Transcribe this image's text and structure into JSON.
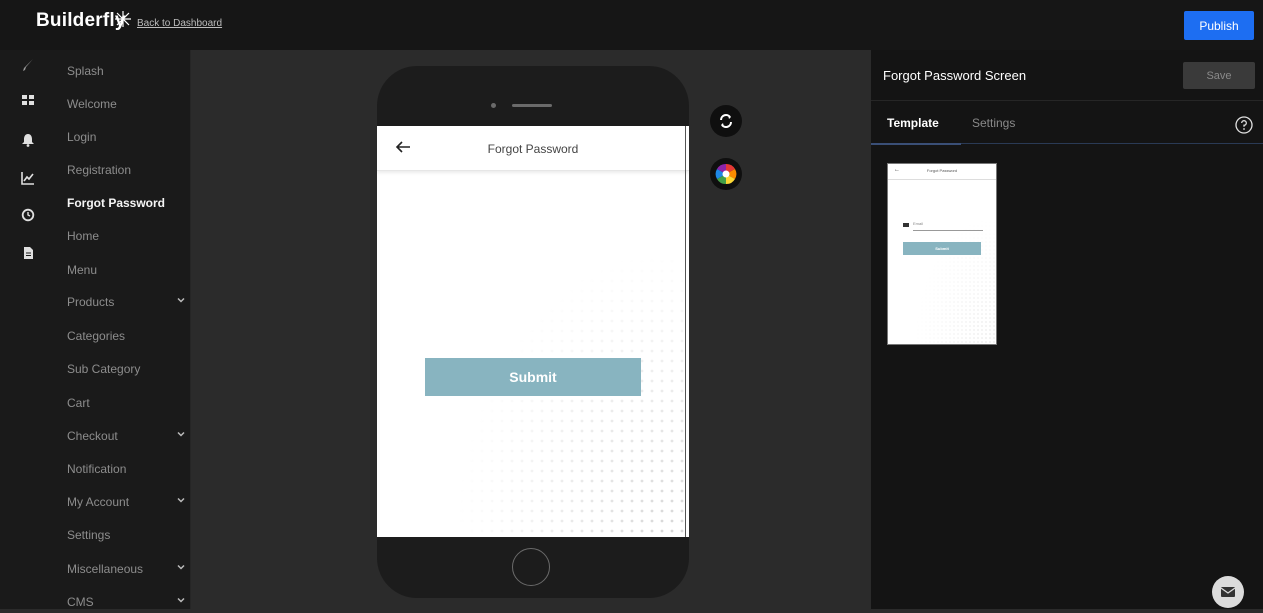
{
  "topbar": {
    "brand": "Builderfly",
    "back_link": "Back to Dashboard",
    "publish_label": "Publish"
  },
  "icon_rail": [
    "brush-icon",
    "grid-icon",
    "bell-icon",
    "chart-icon",
    "clock-icon",
    "document-icon"
  ],
  "screens": {
    "items": [
      {
        "label": "Splash"
      },
      {
        "label": "Welcome"
      },
      {
        "label": "Login"
      },
      {
        "label": "Registration"
      },
      {
        "label": "Forgot Password",
        "active": true
      },
      {
        "label": "Home"
      },
      {
        "label": "Menu"
      },
      {
        "label": "Products",
        "expandable": true
      },
      {
        "label": "Categories"
      },
      {
        "label": "Sub Category"
      },
      {
        "label": "Cart"
      },
      {
        "label": "Checkout",
        "expandable": true
      },
      {
        "label": "Notification"
      },
      {
        "label": "My Account",
        "expandable": true
      },
      {
        "label": "Settings"
      },
      {
        "label": "Miscellaneous",
        "expandable": true
      },
      {
        "label": "CMS",
        "expandable": true
      }
    ]
  },
  "preview": {
    "screen_title": "Forgot Password",
    "email_placeholder": "Email",
    "submit_label": "Submit",
    "accent_color": "#88b4c0"
  },
  "panel": {
    "title": "Forgot Password Screen",
    "save_label": "Save",
    "tabs": [
      {
        "label": "Template",
        "active": true
      },
      {
        "label": "Settings",
        "active": false
      }
    ]
  },
  "colors": {
    "publish": "#1d6ef2",
    "background": "#2b2b2b",
    "sidebar": "#1a1a1a"
  }
}
